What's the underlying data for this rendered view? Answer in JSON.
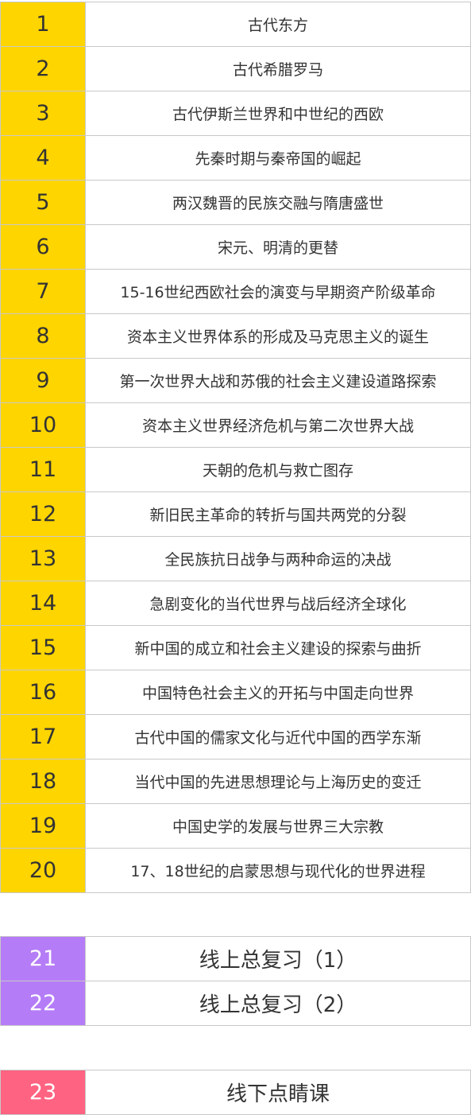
{
  "main_lessons": [
    {
      "num": "1",
      "title": "古代东方"
    },
    {
      "num": "2",
      "title": "古代希腊罗马"
    },
    {
      "num": "3",
      "title": "古代伊斯兰世界和中世纪的西欧"
    },
    {
      "num": "4",
      "title": "先秦时期与秦帝国的崛起"
    },
    {
      "num": "5",
      "title": "两汉魏晋的民族交融与隋唐盛世"
    },
    {
      "num": "6",
      "title": "宋元、明清的更替"
    },
    {
      "num": "7",
      "title": "15-16世纪西欧社会的演变与早期资产阶级革命"
    },
    {
      "num": "8",
      "title": "资本主义世界体系的形成及马克思主义的诞生"
    },
    {
      "num": "9",
      "title": "第一次世界大战和苏俄的社会主义建设道路探索"
    },
    {
      "num": "10",
      "title": "资本主义世界经济危机与第二次世界大战"
    },
    {
      "num": "11",
      "title": "天朝的危机与救亡图存"
    },
    {
      "num": "12",
      "title": "新旧民主革命的转折与国共两党的分裂"
    },
    {
      "num": "13",
      "title": "全民族抗日战争与两种命运的决战"
    },
    {
      "num": "14",
      "title": "急剧变化的当代世界与战后经济全球化"
    },
    {
      "num": "15",
      "title": "新中国的成立和社会主义建设的探索与曲折"
    },
    {
      "num": "16",
      "title": "中国特色社会主义的开拓与中国走向世界"
    },
    {
      "num": "17",
      "title": "古代中国的儒家文化与近代中国的西学东渐"
    },
    {
      "num": "18",
      "title": "当代中国的先进思想理论与上海历史的变迁"
    },
    {
      "num": "19",
      "title": "中国史学的发展与世界三大宗教"
    },
    {
      "num": "20",
      "title": "17、18世纪的启蒙思想与现代化的世界进程"
    }
  ],
  "online_review": [
    {
      "num": "21",
      "title": "线上总复习（1）"
    },
    {
      "num": "22",
      "title": "线上总复习（2）"
    }
  ],
  "offline_review": [
    {
      "num": "23",
      "title": "线下点睛课"
    }
  ],
  "colors": {
    "main_number_bg": "#ffd500",
    "online_number_bg": "#b57cf7",
    "offline_number_bg": "#ff6382",
    "border": "#c8c8c8"
  }
}
